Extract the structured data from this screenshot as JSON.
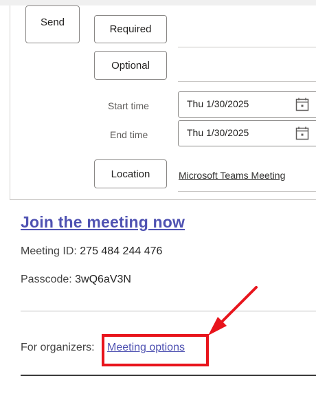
{
  "toolbar": {
    "send_label": "Send",
    "required_label": "Required",
    "optional_label": "Optional",
    "location_label": "Location"
  },
  "schedule": {
    "start_label": "Start time",
    "start_date": "Thu 1/30/2025",
    "end_label": "End time",
    "end_date": "Thu 1/30/2025"
  },
  "location": {
    "value": "Microsoft Teams Meeting"
  },
  "meeting": {
    "join_link": "Join the meeting now",
    "id_label": "Meeting ID: ",
    "id_value": "275 484 244 476",
    "passcode_label": "Passcode: ",
    "passcode_value": "3wQ6aV3N",
    "organizers_label": "For organizers: ",
    "options_link": "Meeting options"
  },
  "annotation": {
    "highlight_color": "#e8141c"
  },
  "icons": {
    "calendar": "calendar-icon"
  }
}
